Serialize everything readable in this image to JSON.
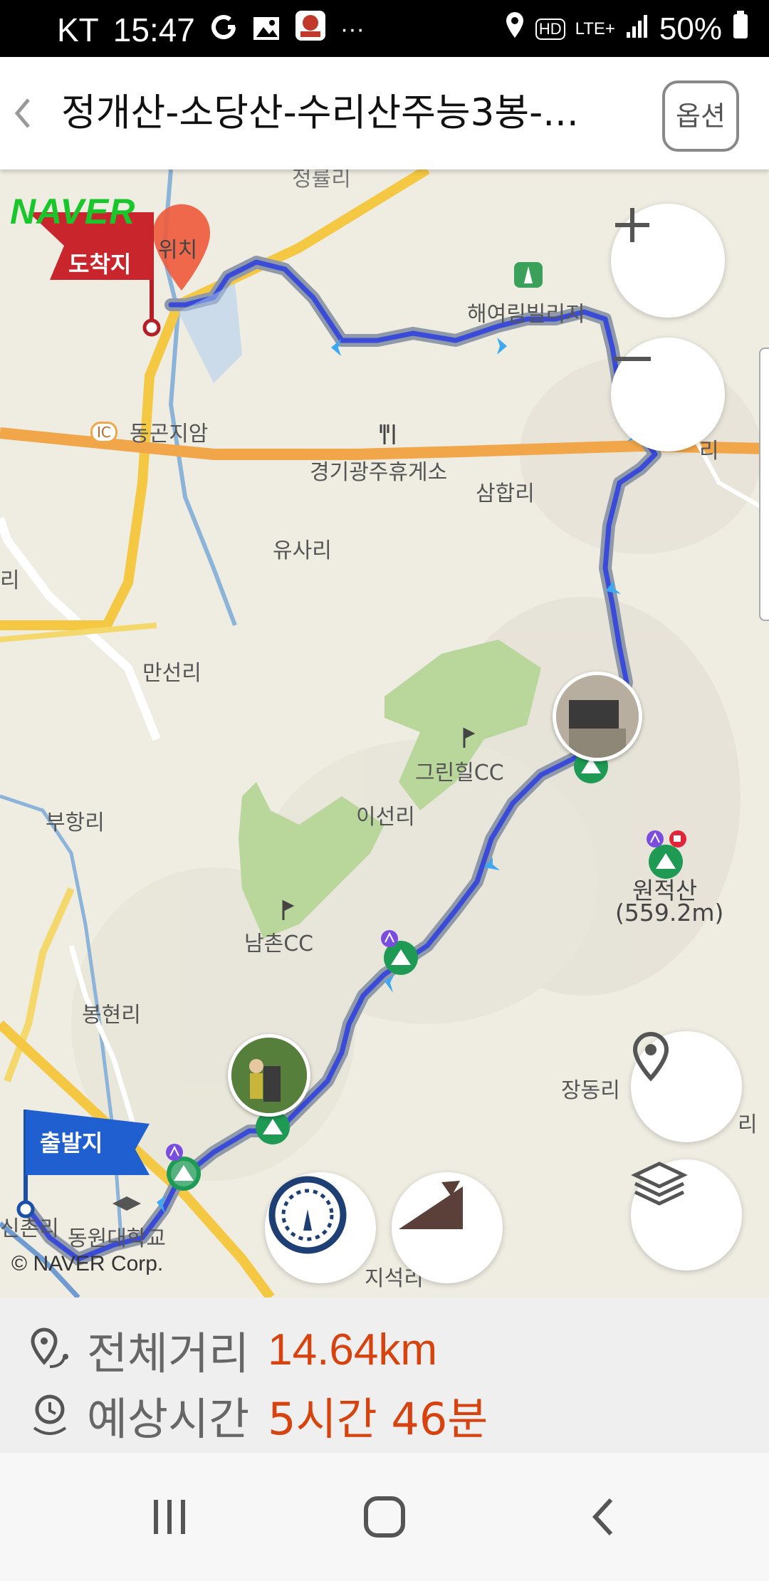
{
  "status_bar": {
    "carrier": "KT",
    "time": "15:47",
    "more": "···",
    "network_hd": "HD",
    "network_lte": "LTE+",
    "battery": "50%"
  },
  "header": {
    "title": "정개산-소당산-수리산주능3봉-...",
    "option_label": "옵션",
    "back_icon": "chevron-left-icon"
  },
  "map": {
    "logo": "NAVER",
    "copyright": "© NAVER Corp.",
    "end_flag": "도착지",
    "start_flag": "출발지",
    "current_location_label": "위치",
    "labels": {
      "haeyeorim": "해여림빌리지",
      "donggonjiam": "동곤지암",
      "ic_badge": "IC",
      "rest_area": "경기광주휴게소",
      "samhapri": "삼합리",
      "yusari": "유사리",
      "manseonri": "만선리",
      "greenhill": "그린힐CC",
      "buhangri": "부항리",
      "iseonri": "이선리",
      "namchon": "남촌CC",
      "wonjeoksan": "원적산",
      "wonjeoksan_elev": "(559.2m)",
      "bonghyeonri": "봉현리",
      "jangdongri": "장동리",
      "jiseokri": "지석리",
      "sinchonri": "신촌리",
      "university": "동원대학교",
      "left_ri": "리",
      "right_ri": "리",
      "right_top_ri": "리",
      "top_label": "정률리"
    },
    "colors": {
      "route": "#3a4bd8",
      "route_outline": "#8f99a8",
      "flag_red": "#c8262c",
      "flag_blue": "#1f5fd0",
      "road_orange": "#f2a64a",
      "road_yellow": "#f4c842",
      "green_area": "#b9d79b"
    }
  },
  "summary": {
    "distance_label": "전체거리",
    "distance_value": "14.64km",
    "time_label": "예상시간",
    "time_value": "5시간 46분"
  }
}
